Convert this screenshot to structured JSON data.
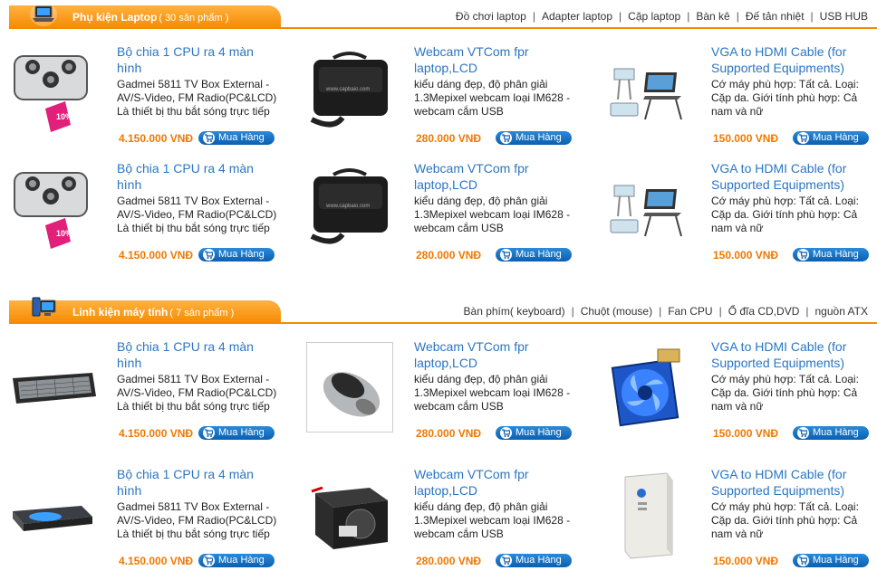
{
  "sections": [
    {
      "title": "Phụ kiện Laptop",
      "count": "( 30 sản phẩm )",
      "icon": "laptop-icon",
      "links": [
        "Đồ chơi laptop",
        "Adapter laptop",
        "Cặp laptop",
        "Bàn kê",
        "Đế tản nhiệt",
        "USB HUB"
      ],
      "products": [
        {
          "name": "Bộ chia 1 CPU ra 4 màn hình",
          "desc": "Gadmei 5811 TV Box External - AV/S-Video, FM Radio(PC&LCD) Là thiết bị thu bắt sóng trực tiếp",
          "price": "4.150.000 VNĐ",
          "buy": "Mua Hàng",
          "image": "cooling-pad-image",
          "image_text": "10%"
        },
        {
          "name": "Webcam VTCom fpr laptop,LCD",
          "desc": "kiểu dáng đẹp, độ phân giải 1.3Mepixel webcam loại IM628 - webcam cắm USB",
          "price": "280.000 VNĐ",
          "buy": "Mua Hàng",
          "image": "laptop-bag-image",
          "image_text": "www.capbaio.com"
        },
        {
          "name": "VGA to HDMI Cable (for Supported Equipments)",
          "desc": "Cớ máy phù hợp: Tất cả. Loại: Cặp da. Giới tính phù hợp: Cả nam và nữ",
          "price": "150.000 VNĐ",
          "buy": "Mua Hàng",
          "image": "laptop-stand-image",
          "image_text": ""
        },
        {
          "name": "Bộ chia 1 CPU ra 4 màn hình",
          "desc": "Gadmei 5811 TV Box External - AV/S-Video, FM Radio(PC&LCD) Là thiết bị thu bắt sóng trực tiếp",
          "price": "4.150.000 VNĐ",
          "buy": "Mua Hàng",
          "image": "cooling-pad-image",
          "image_text": "10%"
        },
        {
          "name": "Webcam VTCom fpr laptop,LCD",
          "desc": "kiểu dáng đẹp, độ phân giải 1.3Mepixel webcam loại IM628 - webcam cắm USB",
          "price": "280.000 VNĐ",
          "buy": "Mua Hàng",
          "image": "laptop-bag-image",
          "image_text": "www.capbaio.com"
        },
        {
          "name": "VGA to HDMI Cable (for Supported Equipments)",
          "desc": "Cớ máy phù hợp: Tất cả. Loại: Cặp da. Giới tính phù hợp: Cả nam và nữ",
          "price": "150.000 VNĐ",
          "buy": "Mua Hàng",
          "image": "laptop-stand-image",
          "image_text": ""
        }
      ]
    },
    {
      "title": "Linh kiện máy tính",
      "count": "( 7 sản phẩm )",
      "icon": "desktop-computer-icon",
      "links": [
        "Bàn phím( keyboard)",
        "Chuột (mouse)",
        "Fan CPU",
        "Ổ đĩa CD,DVD",
        "nguồn ATX"
      ],
      "products": [
        {
          "name": "Bộ chia 1 CPU ra 4 màn hình",
          "desc": "Gadmei 5811 TV Box External - AV/S-Video, FM Radio(PC&LCD) Là thiết bị thu bắt sóng trực tiếp",
          "price": "4.150.000 VNĐ",
          "buy": "Mua Hàng",
          "image": "keyboard-image",
          "image_text": ""
        },
        {
          "name": "Webcam VTCom fpr laptop,LCD",
          "desc": "kiểu dáng đẹp, độ phân giải 1.3Mepixel webcam loại IM628 - webcam cắm USB",
          "price": "280.000 VNĐ",
          "buy": "Mua Hàng",
          "image": "mouse-image",
          "image_text": ""
        },
        {
          "name": "VGA to HDMI Cable (for Supported Equipments)",
          "desc": "Cớ máy phù hợp: Tất cả. Loại: Cặp da. Giới tính phù hợp: Cả nam và nữ",
          "price": "150.000 VNĐ",
          "buy": "Mua Hàng",
          "image": "cpu-fan-image",
          "image_text": ""
        },
        {
          "name": "Bộ chia 1 CPU ra 4 màn hình",
          "desc": "Gadmei 5811 TV Box External - AV/S-Video, FM Radio(PC&LCD) Là thiết bị thu bắt sóng trực tiếp",
          "price": "4.150.000 VNĐ",
          "buy": "Mua Hàng",
          "image": "dvd-drive-image",
          "image_text": ""
        },
        {
          "name": "Webcam VTCom fpr laptop,LCD",
          "desc": "kiểu dáng đẹp, độ phân giải 1.3Mepixel webcam loại IM628 - webcam cắm USB",
          "price": "280.000 VNĐ",
          "buy": "Mua Hàng",
          "image": "power-supply-image",
          "image_text": ""
        },
        {
          "name": "VGA to HDMI Cable (for Supported Equipments)",
          "desc": "Cớ máy phù hợp: Tất cả. Loại: Cặp da. Giới tính phù hợp: Cả nam và nữ",
          "price": "150.000 VNĐ",
          "buy": "Mua Hàng",
          "image": "ups-image",
          "image_text": ""
        }
      ]
    }
  ],
  "colors": {
    "accent": "#f58a00",
    "link": "#2a76c4",
    "price": "#f07800",
    "button": "#0b5fb0"
  }
}
